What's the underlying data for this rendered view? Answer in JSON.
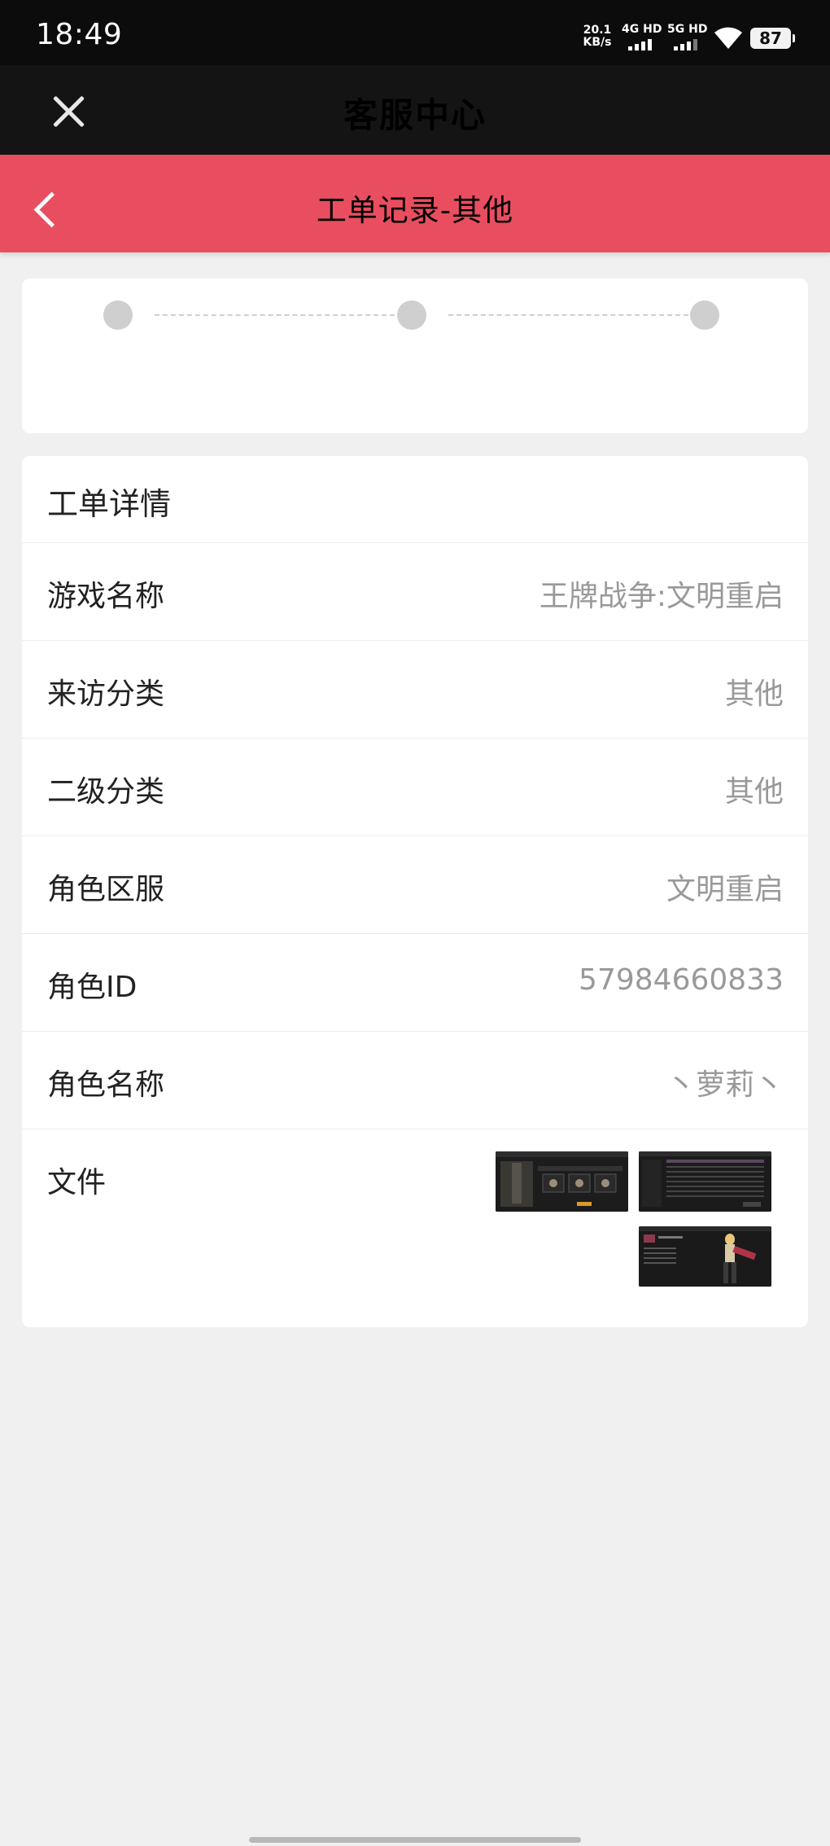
{
  "status_bar": {
    "time": "18:49",
    "net_speed_value": "20.1",
    "net_speed_unit": "KB/s",
    "signal_1": "4G HD",
    "signal_2": "5G HD",
    "battery": "87"
  },
  "header": {
    "title": "客服中心",
    "close_icon": "close-icon"
  },
  "sub_header": {
    "title": "工单记录-其他",
    "back_icon": "back-icon",
    "color": "#e84e5f"
  },
  "progress": {
    "steps": 3
  },
  "detail": {
    "title": "工单详情",
    "rows": [
      {
        "label": "游戏名称",
        "value": "王牌战争:文明重启"
      },
      {
        "label": "来访分类",
        "value": "其他"
      },
      {
        "label": "二级分类",
        "value": "其他"
      },
      {
        "label": "角色区服",
        "value": "文明重启"
      },
      {
        "label": "角色ID",
        "value": "57984660833"
      },
      {
        "label": "角色名称",
        "value": "丶萝莉丶"
      }
    ],
    "files_label": "文件"
  }
}
